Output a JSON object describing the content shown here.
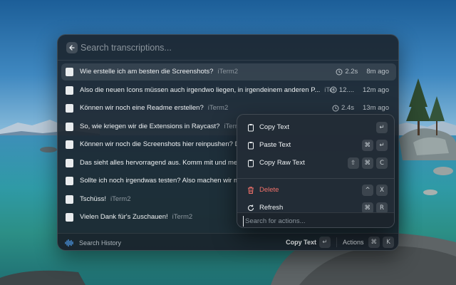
{
  "search": {
    "placeholder": "Search transcriptions..."
  },
  "transcriptions": [
    {
      "text": "Wie erstelle ich am besten die Screenshots?",
      "app": "iTerm2",
      "duration": "2.2s",
      "ago": "8m ago"
    },
    {
      "text": "Also die neuen Icons müssen auch irgendwo liegen, in irgendeinem anderen P...",
      "app": "iTerm2",
      "duration": "12....",
      "ago": "12m ago"
    },
    {
      "text": "Können wir noch eine Readme erstellen?",
      "app": "iTerm2",
      "duration": "2.4s",
      "ago": "13m ago"
    },
    {
      "text": "So, wie kriegen wir die Extensions in Raycast?",
      "app": "iTerm2",
      "duration": "",
      "ago": ""
    },
    {
      "text": "Können wir noch die Screenshots hier reinpushen? Die s",
      "app": "",
      "duration": "",
      "ago": ""
    },
    {
      "text": "Das sieht alles hervorragend aus. Komm mit und merge.",
      "app": "",
      "duration": "",
      "ago": ""
    },
    {
      "text": "Sollte ich noch irgendwas testen? Also machen wir mal d",
      "app": "",
      "duration": "",
      "ago": ""
    },
    {
      "text": "Tschüss!",
      "app": "iTerm2",
      "duration": "",
      "ago": ""
    },
    {
      "text": "Vielen Dank für's Zuschauen!",
      "app": "iTerm2",
      "duration": "",
      "ago": ""
    }
  ],
  "footer": {
    "title": "Search History",
    "primary_action": "Copy Text",
    "primary_key": "↵",
    "actions_label": "Actions",
    "actions_keys": [
      "⌘",
      "K"
    ]
  },
  "actions_panel": {
    "items": [
      {
        "label": "Copy Text",
        "icon": "clipboard-icon",
        "keys": [
          "↵"
        ]
      },
      {
        "label": "Paste Text",
        "icon": "clipboard-icon",
        "keys": [
          "⌘",
          "↵"
        ]
      },
      {
        "label": "Copy Raw Text",
        "icon": "clipboard-icon",
        "keys": [
          "⇧",
          "⌘",
          "C"
        ]
      },
      {
        "label": "Delete",
        "icon": "trash-icon",
        "keys": [
          "^",
          "X"
        ],
        "style": "danger"
      },
      {
        "label": "Refresh",
        "icon": "refresh-icon",
        "keys": [
          "⌘",
          "R"
        ]
      }
    ],
    "search_placeholder": "Search for actions..."
  },
  "colors": {
    "window_bg": "#1c2630",
    "danger": "#f0716a",
    "selected_row": "#2f3a44"
  }
}
